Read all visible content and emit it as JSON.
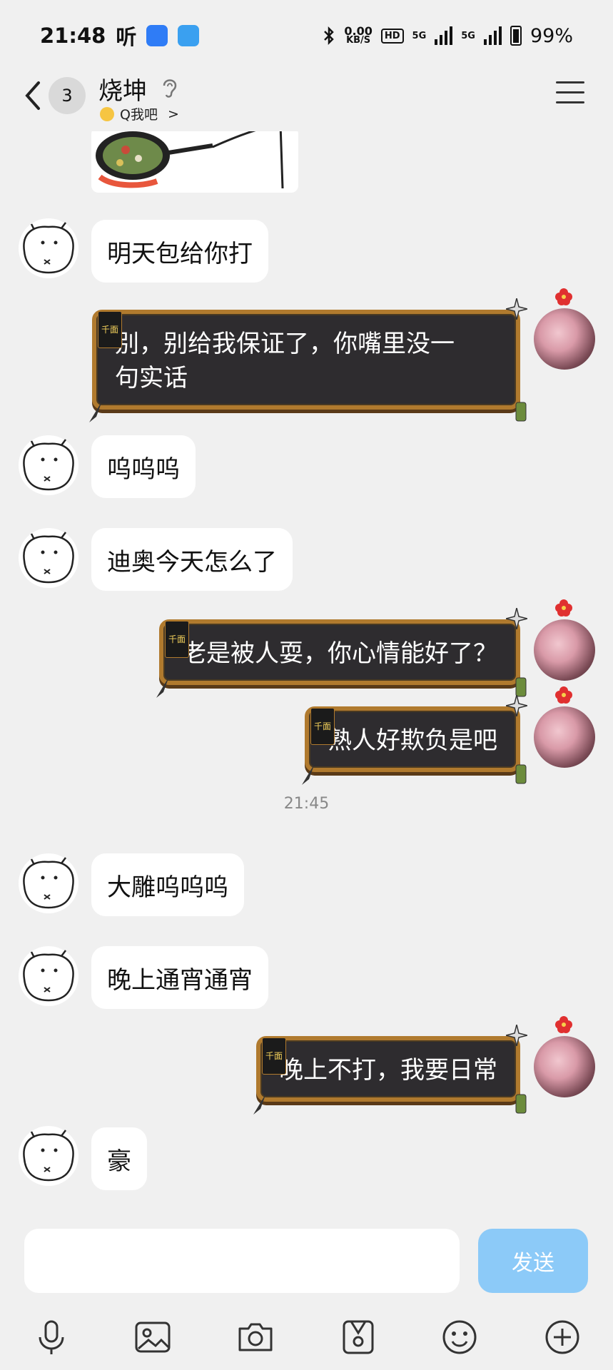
{
  "status_bar": {
    "time": "21:48",
    "listen": "听",
    "net_speed_value": "0.00",
    "net_speed_unit": "KB/S",
    "hd": "HD",
    "sim1": "5G",
    "sim2": "5G",
    "battery": "99%"
  },
  "header": {
    "unread_count": "3",
    "name": "烧坤",
    "subtitle": "Q我吧",
    "subtitle_arrow": ">"
  },
  "messages": {
    "m1": "明天包给你打",
    "m2_line1": "别，别给我保证了，你嘴里没一",
    "m2_line2": "句实话",
    "m3": "呜呜呜",
    "m4": "迪奥今天怎么了",
    "m5": "老是被人耍，你心情能好了？",
    "m6": "熟人好欺负是吧",
    "time_divider": "21:45",
    "m7": "大雕呜呜呜",
    "m8": "晚上通宵通宵",
    "m9": "晚上不打，我要日常",
    "m10": "豪",
    "bubble_tag": "千面"
  },
  "input": {
    "placeholder": "",
    "send_label": "发送"
  },
  "colors": {
    "background": "#f0f0f0",
    "send_button": "#8ccaf8",
    "bubble_dark": "#2e2c2f",
    "bubble_border": "#b07a2e"
  },
  "icons": [
    "back-icon",
    "ear-icon",
    "menu-icon",
    "mic-icon",
    "image-icon",
    "camera-icon",
    "sticker-icon",
    "emoji-icon",
    "plus-icon"
  ]
}
